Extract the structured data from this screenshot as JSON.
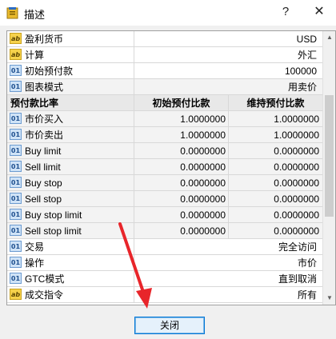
{
  "window": {
    "title": "描述",
    "help_glyph": "?",
    "close_glyph": "✕"
  },
  "properties_top": [
    {
      "icon": "ab",
      "label": "盈利货币",
      "value": "USD"
    },
    {
      "icon": "ab",
      "label": "计算",
      "value": "外汇"
    },
    {
      "icon": "num",
      "label": "初始预付款",
      "value": "100000"
    },
    {
      "icon": "num",
      "label": "图表模式",
      "value": "用卖价"
    }
  ],
  "margin_table": {
    "headers": [
      "预付款比率",
      "初始预付比款",
      "维持预付比款"
    ],
    "rows": [
      {
        "label": "市价买入",
        "initial": "1.0000000",
        "maintenance": "1.0000000"
      },
      {
        "label": "市价卖出",
        "initial": "1.0000000",
        "maintenance": "1.0000000"
      },
      {
        "label": "Buy limit",
        "initial": "0.0000000",
        "maintenance": "0.0000000"
      },
      {
        "label": "Sell limit",
        "initial": "0.0000000",
        "maintenance": "0.0000000"
      },
      {
        "label": "Buy stop",
        "initial": "0.0000000",
        "maintenance": "0.0000000"
      },
      {
        "label": "Sell stop",
        "initial": "0.0000000",
        "maintenance": "0.0000000"
      },
      {
        "label": "Buy stop limit",
        "initial": "0.0000000",
        "maintenance": "0.0000000"
      },
      {
        "label": "Sell stop limit",
        "initial": "0.0000000",
        "maintenance": "0.0000000"
      }
    ]
  },
  "properties_bottom": [
    {
      "icon": "num",
      "label": "交易",
      "value": "完全访问"
    },
    {
      "icon": "num",
      "label": "操作",
      "value": "市价"
    },
    {
      "icon": "num",
      "label": "GTC模式",
      "value": "直到取消"
    },
    {
      "icon": "ab",
      "label": "成交指令",
      "value": "所有"
    }
  ],
  "icon_text": {
    "ab": "ab",
    "num": "01"
  },
  "footer": {
    "close_button": "关闭"
  },
  "colors": {
    "accent": "#0078d7",
    "arrow": "#e8252a"
  },
  "scrollbar": {
    "up": "▲",
    "down": "▼"
  }
}
